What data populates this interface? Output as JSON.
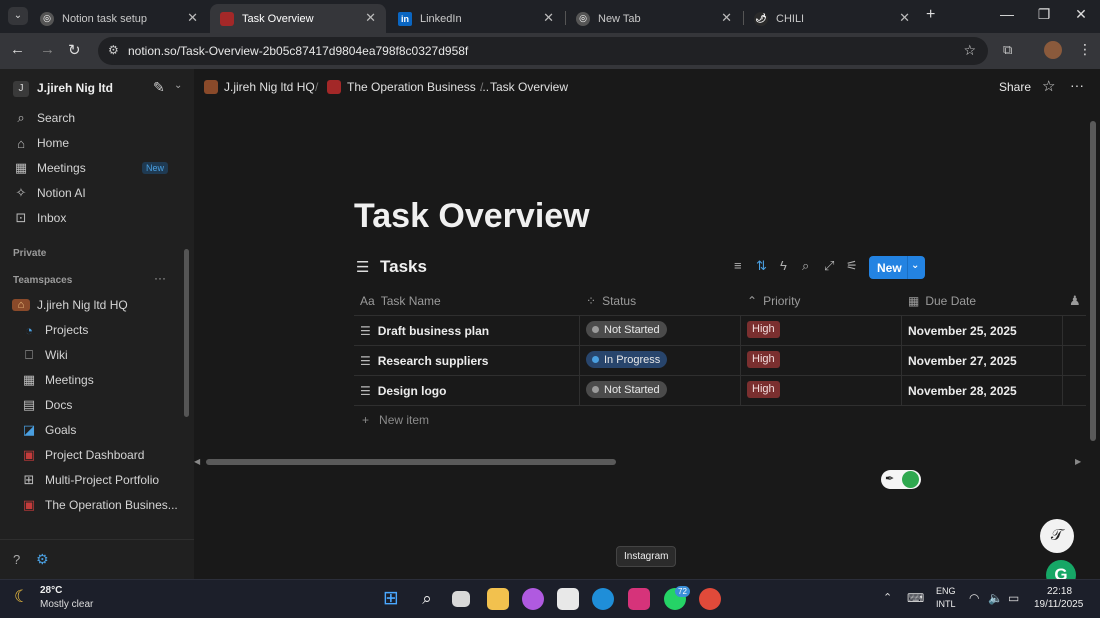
{
  "browser": {
    "tabs": [
      {
        "title": "Notion task setup",
        "active": false
      },
      {
        "title": "Task Overview",
        "active": true
      },
      {
        "title": "LinkedIn",
        "active": false
      },
      {
        "title": "New Tab",
        "active": false
      },
      {
        "title": "CHILI",
        "active": false
      }
    ],
    "url": "notion.so/Task-Overview-2b05c87417d9804ea798f8c0327d958f"
  },
  "sidebar": {
    "workspace": "J.jireh Nig ltd",
    "workspace_initial": "J",
    "nav": [
      {
        "label": "Search",
        "icon": "search-icon"
      },
      {
        "label": "Home",
        "icon": "home-icon"
      },
      {
        "label": "Meetings",
        "icon": "meetings-icon",
        "badge": "New"
      },
      {
        "label": "Notion AI",
        "icon": "notion-ai-icon"
      },
      {
        "label": "Inbox",
        "icon": "inbox-icon"
      }
    ],
    "private_heading": "Private",
    "teamspaces_heading": "Teamspaces",
    "teamspace": "J.jireh Nig ltd HQ",
    "teamspace_items": [
      {
        "label": "Projects",
        "icon": "projects-icon"
      },
      {
        "label": "Wiki",
        "icon": "wiki-icon"
      },
      {
        "label": "Meetings",
        "icon": "meetings-icon"
      },
      {
        "label": "Docs",
        "icon": "docs-icon"
      },
      {
        "label": "Goals",
        "icon": "goals-icon"
      },
      {
        "label": "Project Dashboard",
        "icon": "briefcase-icon"
      },
      {
        "label": "Multi-Project Portfolio",
        "icon": "portfolio-icon"
      },
      {
        "label": "The Operation Busines...",
        "icon": "briefcase-icon"
      }
    ]
  },
  "header": {
    "breadcrumbs": [
      "J.jireh Nig ltd HQ",
      "The Operation Business ...",
      "Task Overview"
    ],
    "share_label": "Share"
  },
  "page": {
    "title": "Task Overview",
    "database_title": "Tasks",
    "new_button": "New",
    "columns": [
      "Task Name",
      "Status",
      "Priority",
      "Due Date"
    ],
    "rows": [
      {
        "name": "Draft business plan",
        "status": "Not Started",
        "priority": "High",
        "due": "November 25, 2025"
      },
      {
        "name": "Research suppliers",
        "status": "In Progress",
        "priority": "High",
        "due": "November 27, 2025"
      },
      {
        "name": "Design logo",
        "status": "Not Started",
        "priority": "High",
        "due": "November 28, 2025"
      }
    ],
    "new_item_label": "New item"
  },
  "colors": {
    "accent": "#2383e2",
    "status_not_started": "#4b4b4b",
    "status_in_progress": "#28456c",
    "priority_high": "#7a2f2f"
  },
  "taskbar": {
    "weather_temp": "28°C",
    "weather_desc": "Mostly clear",
    "tooltip": "Instagram",
    "whatsapp_badge": "72",
    "lang_1": "ENG",
    "lang_2": "INTL",
    "time": "22:18",
    "date": "19/11/2025"
  }
}
